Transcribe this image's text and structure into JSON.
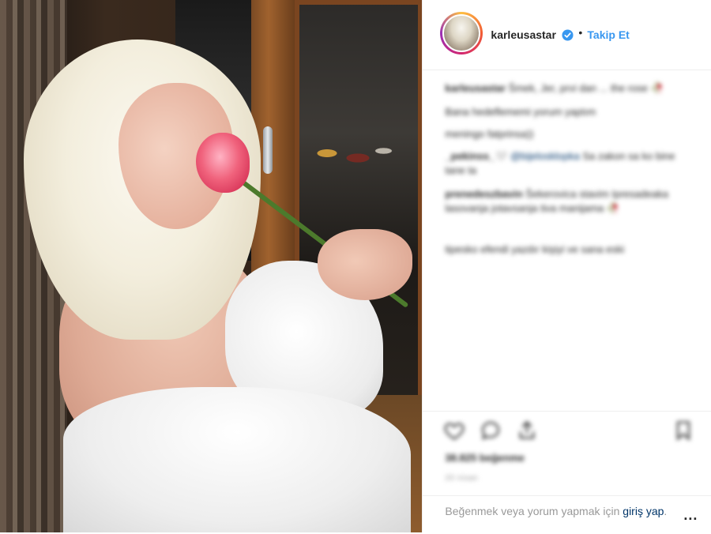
{
  "header": {
    "username": "karleusastar",
    "separator": "•",
    "follow_label": "Takip Et",
    "verified_icon": "verified-badge-icon"
  },
  "comments": [
    {
      "user": "karleusastar",
      "text": "Šmek, Jer, prvi dan ... the rose 🥀"
    },
    {
      "user": "",
      "text": "Bana hedeflememi yorum yaptım"
    },
    {
      "user": "",
      "text": "meningo fatprinsa))"
    },
    {
      "user": "_pekinss_🤍",
      "mention": "@bijelosklopka",
      "text": "Sa zakon sa ko bine tane ta"
    },
    {
      "user": "prenedeszbavin",
      "text": "Šekerovica stavim Ipresadeaka lasovanja jotavsanja tiva manijama 🥀"
    },
    {
      "user": "",
      "text": "tipesko efendi yazdır kişiyi ve sana eski"
    }
  ],
  "actions": {
    "like_icon": "heart-icon",
    "comment_icon": "comment-icon",
    "share_icon": "share-icon",
    "save_icon": "bookmark-icon",
    "likes": "38.825 beğenme",
    "date": "20 nisan"
  },
  "login": {
    "prefix": "Beğenmek veya yorum yapmak için ",
    "link": "giriş yap",
    "suffix": ".",
    "more": "..."
  },
  "colors": {
    "link_blue": "#3897f0",
    "dark_link": "#003569",
    "border": "#efefef"
  }
}
